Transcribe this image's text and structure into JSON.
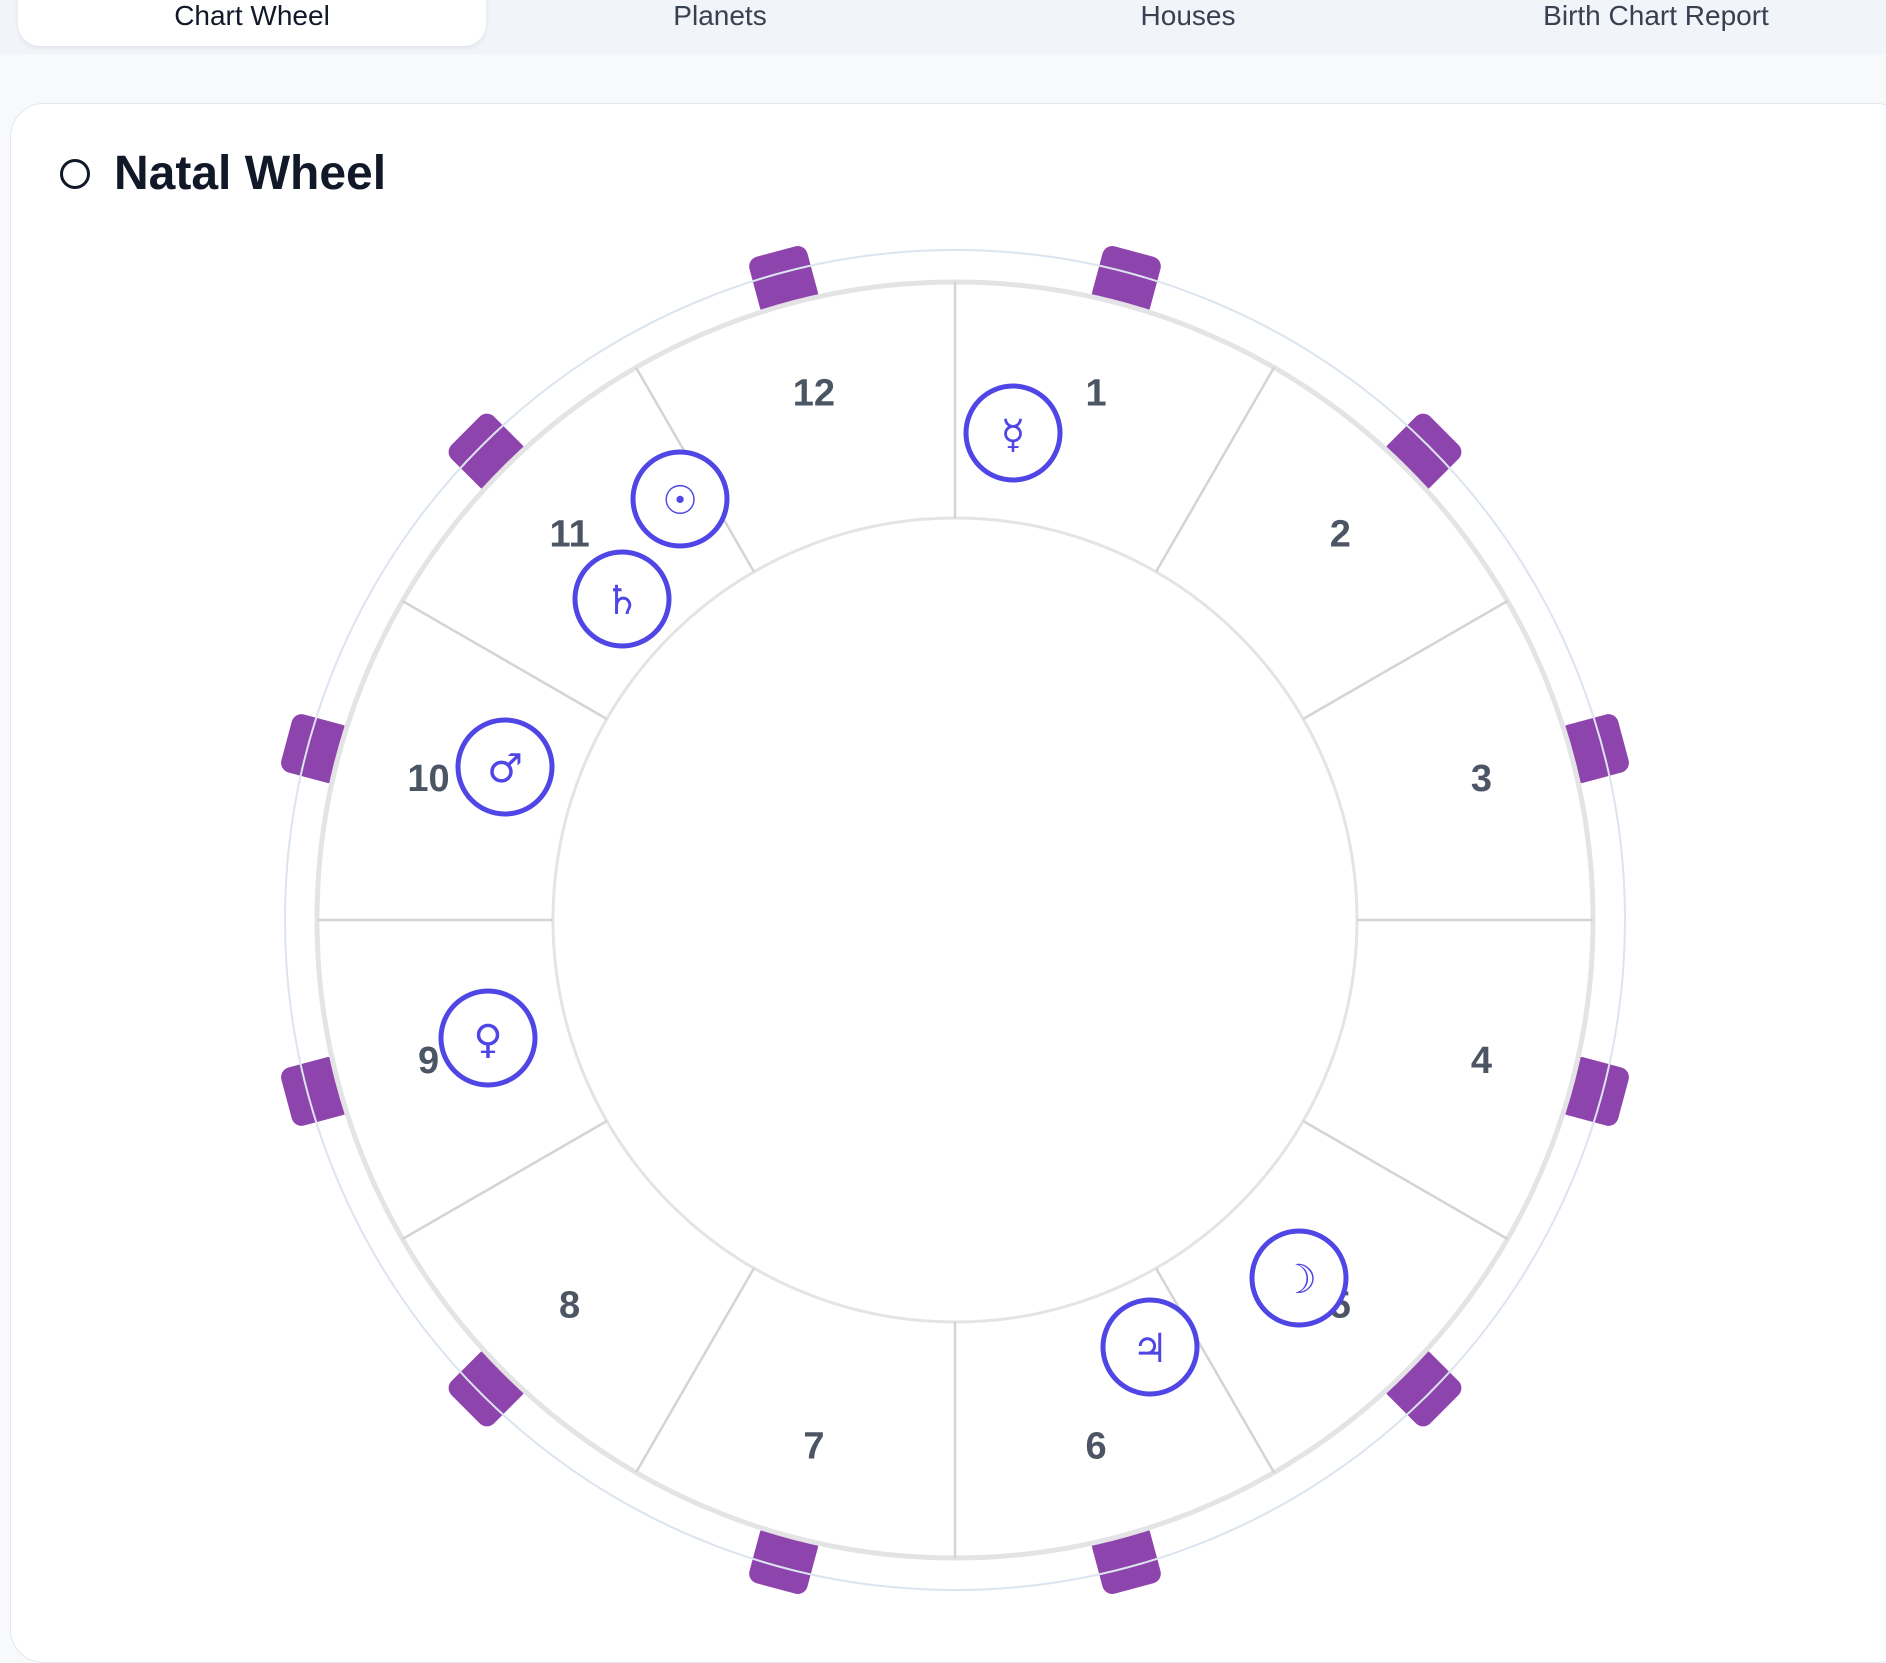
{
  "tabs": [
    {
      "label": "Chart Wheel",
      "active": true
    },
    {
      "label": "Planets",
      "active": false
    },
    {
      "label": "Houses",
      "active": false
    },
    {
      "label": "Birth Chart Report",
      "active": false
    }
  ],
  "card": {
    "title": "Natal Wheel",
    "title_icon": "circle-outline-icon"
  },
  "wheel": {
    "houses": [
      "1",
      "2",
      "3",
      "4",
      "5",
      "6",
      "7",
      "8",
      "9",
      "10",
      "11",
      "12"
    ],
    "planets": [
      {
        "name": "mercury",
        "glyph": "☿",
        "icon": "mercury-icon"
      },
      {
        "name": "sun",
        "glyph": "☉",
        "icon": "sun-icon"
      },
      {
        "name": "saturn",
        "glyph": "♄",
        "icon": "saturn-icon"
      },
      {
        "name": "mars",
        "glyph": "♂",
        "icon": "mars-icon"
      },
      {
        "name": "venus",
        "glyph": "♀",
        "icon": "venus-icon"
      },
      {
        "name": "moon",
        "glyph": "☽",
        "icon": "moon-icon"
      },
      {
        "name": "jupiter",
        "glyph": "♃",
        "icon": "jupiter-icon"
      }
    ],
    "sign_badge_count": 12,
    "colors": {
      "planet": "#4f46e5",
      "sign_badge": "#8e44ad",
      "lines": "#d4d4d8",
      "house_text": "#4b5563"
    }
  }
}
